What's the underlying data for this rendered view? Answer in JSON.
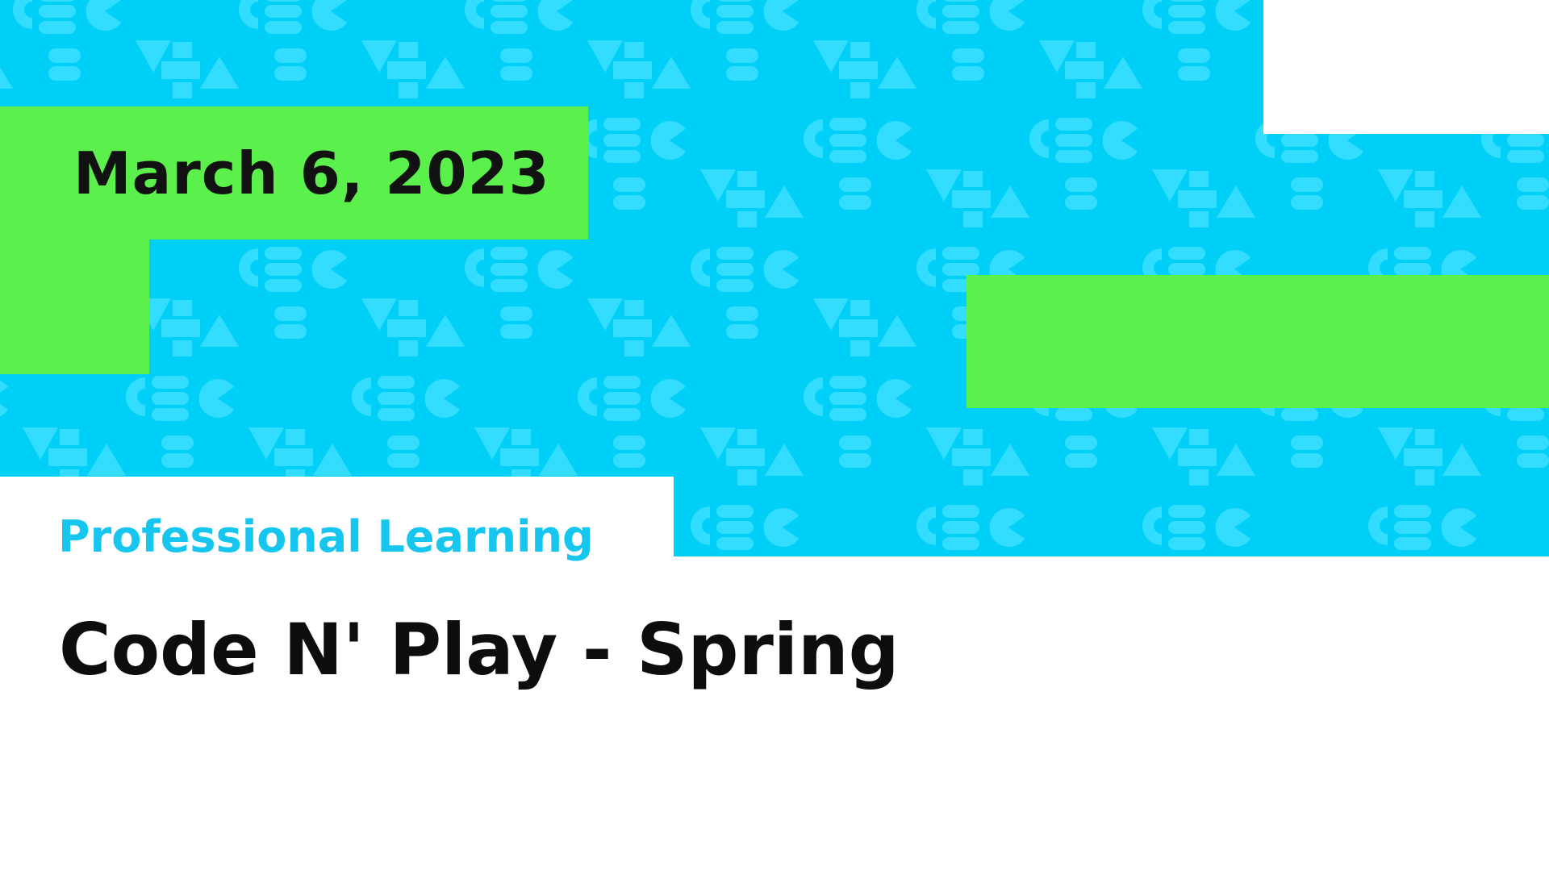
{
  "slide": {
    "date": "March 6, 2023",
    "eyebrow": "Professional Learning",
    "title": "Code N' Play - Spring"
  },
  "colors": {
    "pattern_background": "#00d0f8",
    "pattern_shapes": "#33ddff",
    "accent_green": "#5bf04b",
    "eyebrow_text": "#16c6ef",
    "title_text": "#0d0d0d",
    "page_background": "#ffffff"
  },
  "pattern": {
    "motif": "CS logo shapes (C, S, pac-man, triangles, blocks)"
  }
}
